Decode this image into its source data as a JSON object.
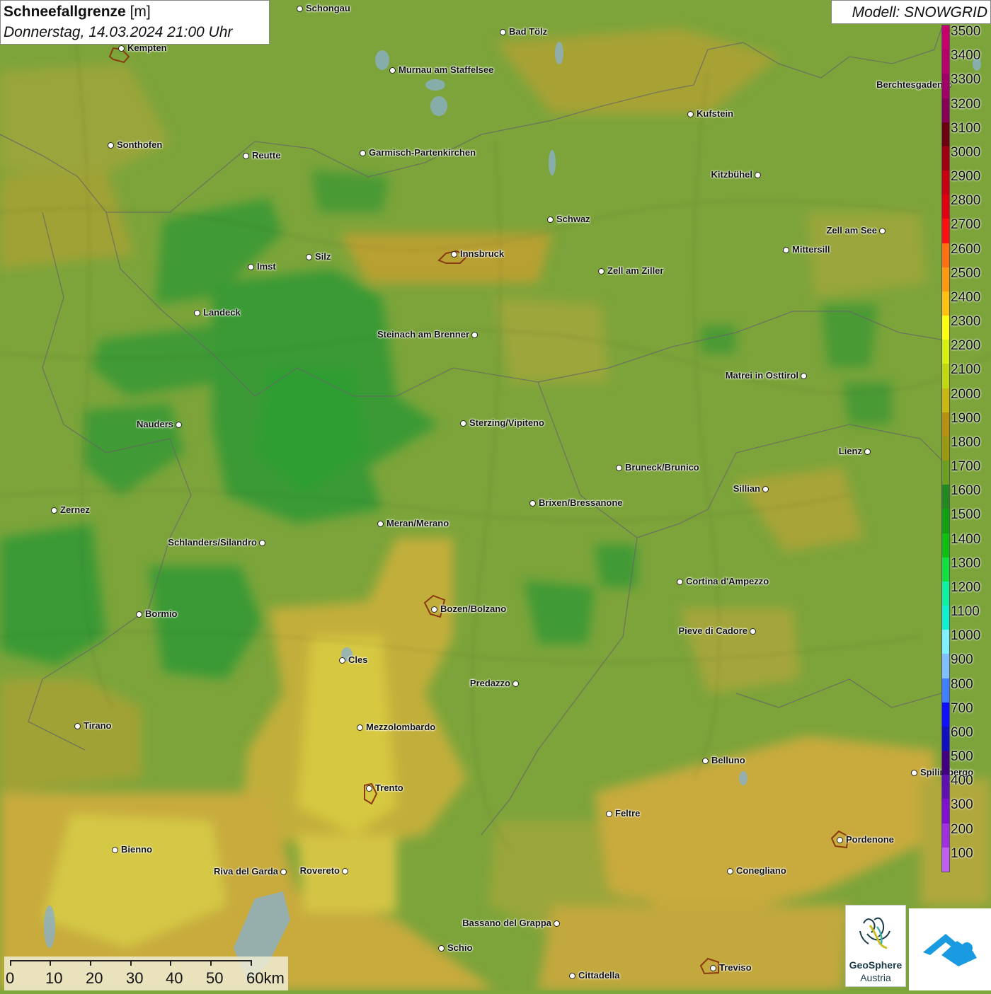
{
  "title": {
    "name": "Schneefallgrenze",
    "unit": "[m]",
    "datetime": "Donnerstag, 14.03.2024 21:00 Uhr"
  },
  "model_label": "Modell: SNOWGRID",
  "legend": {
    "labels": [
      "3500",
      "3400",
      "3300",
      "3200",
      "3100",
      "3000",
      "2900",
      "2800",
      "2700",
      "2600",
      "2500",
      "2400",
      "2300",
      "2200",
      "2100",
      "2000",
      "1900",
      "1800",
      "1700",
      "1600",
      "1500",
      "1400",
      "1300",
      "1200",
      "1100",
      "1000",
      "900",
      "800",
      "700",
      "600",
      "500",
      "400",
      "300",
      "200",
      "100"
    ],
    "colors": [
      "#c8006e",
      "#b8006a",
      "#a00066",
      "#880056",
      "#6a0010",
      "#a00010",
      "#c80010",
      "#e00010",
      "#ff1010",
      "#ff7010",
      "#ff9a10",
      "#ffc010",
      "#ffff10",
      "#d8f010",
      "#c0d810",
      "#c8b810",
      "#b89010",
      "#9a9a10",
      "#6ea020",
      "#208a20",
      "#10a010",
      "#10c010",
      "#10e040",
      "#10f0a0",
      "#10f0d0",
      "#80f0ff",
      "#80c0ff",
      "#4080ff",
      "#1010ff",
      "#1010c0",
      "#400080",
      "#6010b0",
      "#8010d0",
      "#a030e0",
      "#c060f0"
    ]
  },
  "cities": [
    {
      "name": "Schongau"
    },
    {
      "name": "Bad Tölz"
    },
    {
      "name": "Kempten"
    },
    {
      "name": "Murnau am Staffelsee"
    },
    {
      "name": "Berchtesgaden"
    },
    {
      "name": "Kufstein"
    },
    {
      "name": "Sonthofen"
    },
    {
      "name": "Reutte"
    },
    {
      "name": "Garmisch-Partenkirchen"
    },
    {
      "name": "Kitzbühel"
    },
    {
      "name": "Schwaz"
    },
    {
      "name": "Zell am See"
    },
    {
      "name": "Innsbruck"
    },
    {
      "name": "Mittersill"
    },
    {
      "name": "Imst"
    },
    {
      "name": "Silz"
    },
    {
      "name": "Zell am Ziller"
    },
    {
      "name": "Landeck"
    },
    {
      "name": "Steinach am Brenner"
    },
    {
      "name": "Matrei in Osttirol"
    },
    {
      "name": "Nauders"
    },
    {
      "name": "Sterzing/Vipiteno"
    },
    {
      "name": "Lienz"
    },
    {
      "name": "Bruneck/Brunico"
    },
    {
      "name": "Sillian"
    },
    {
      "name": "Zernez"
    },
    {
      "name": "Brixen/Bressanone"
    },
    {
      "name": "Meran/Merano"
    },
    {
      "name": "Schlanders/Silandro"
    },
    {
      "name": "Cortina d'Ampezzo"
    },
    {
      "name": "Bozen/Bolzano"
    },
    {
      "name": "Bormio"
    },
    {
      "name": "Pieve di Cadore"
    },
    {
      "name": "Cles"
    },
    {
      "name": "Predazzo"
    },
    {
      "name": "Tirano"
    },
    {
      "name": "Mezzolombardo"
    },
    {
      "name": "Belluno"
    },
    {
      "name": "Spilimbergo"
    },
    {
      "name": "Trento"
    },
    {
      "name": "Feltre"
    },
    {
      "name": "Pordenone"
    },
    {
      "name": "Bienno"
    },
    {
      "name": "Riva del Garda"
    },
    {
      "name": "Rovereto"
    },
    {
      "name": "Conegliano"
    },
    {
      "name": "Bassano del Grappa"
    },
    {
      "name": "Schio"
    },
    {
      "name": "Treviso"
    },
    {
      "name": "Cittadella"
    }
  ],
  "scale": {
    "labels": [
      "0",
      "10",
      "20",
      "30",
      "40",
      "50",
      "60km"
    ]
  },
  "logo": {
    "line1": "GeoSphere",
    "line2": "Austria"
  }
}
